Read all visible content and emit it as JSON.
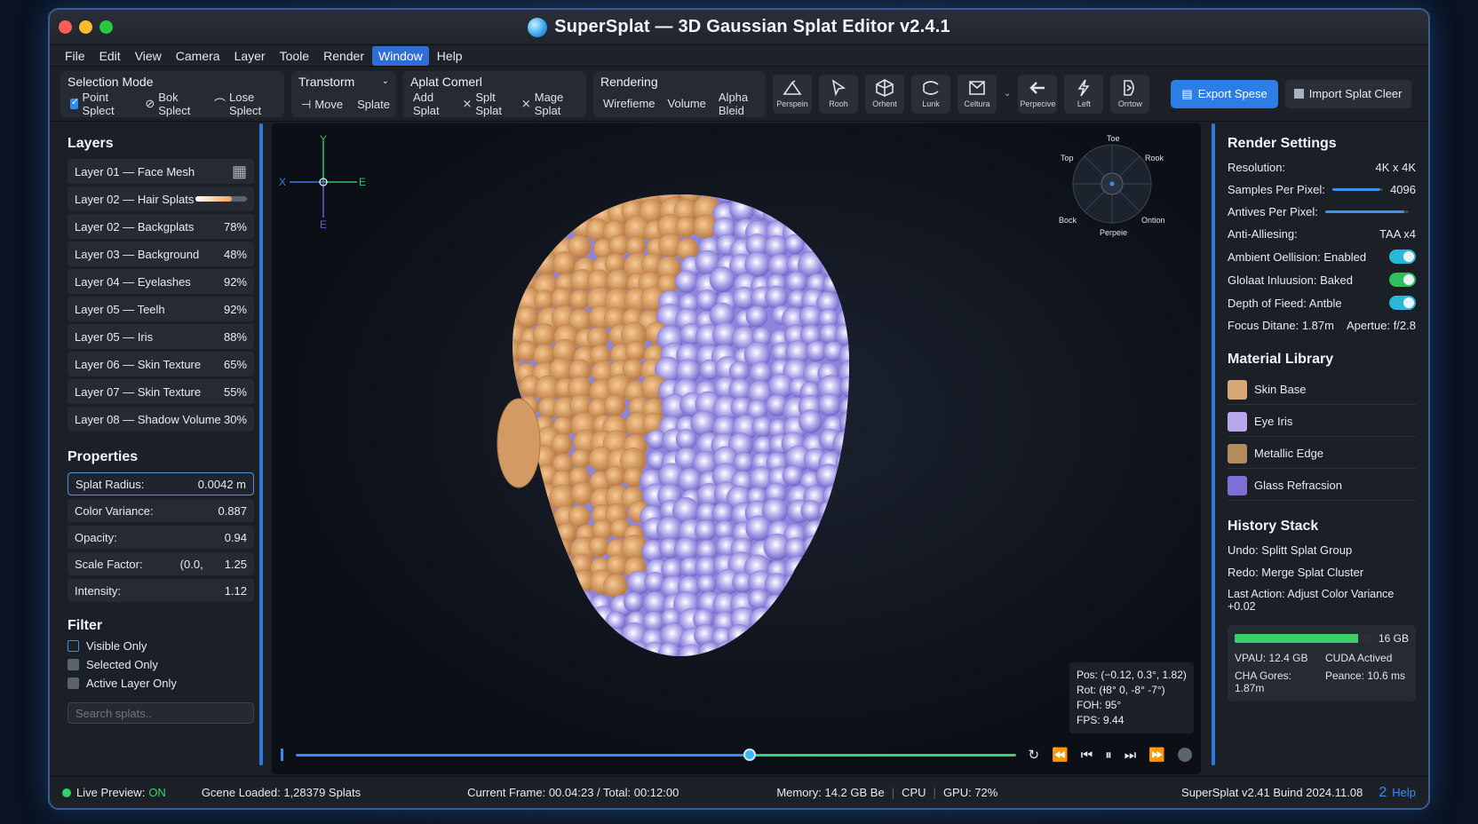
{
  "window": {
    "title": "SuperSplat — 3D Gaussian Splat Editor v2.4.1"
  },
  "menu": [
    "File",
    "Edit",
    "View",
    "Camera",
    "Layer",
    "Toole",
    "Render",
    "Window",
    "Help"
  ],
  "menu_active": "Window",
  "toolbar": {
    "selection": {
      "title": "Selection Mode",
      "items": [
        "Point Splect",
        "Bok Splect",
        "Lose Splect"
      ]
    },
    "transform": {
      "title": "Transtorm",
      "items": [
        "Move",
        "Splate"
      ]
    },
    "aplat": {
      "title": "Aplat Comerl",
      "items": [
        "Add Splat",
        "Splt Splat",
        "Mage Splat"
      ]
    },
    "rendering": {
      "title": "Rendering",
      "items": [
        "Wirefieme",
        "Volume",
        "Alpha Bleid"
      ]
    },
    "views": [
      "Perspein",
      "Rooh",
      "Orhent",
      "Lunk",
      "Celtura",
      "Perpecive",
      "Left",
      "Orrtow"
    ],
    "export_label": "Export Spese",
    "import_label": "Import Splat Cleer"
  },
  "layers_title": "Layers",
  "layers": [
    {
      "name": "Layer 01 — Face Mesh",
      "value": ""
    },
    {
      "name": "Layer 02 — Hair Splats",
      "value": ""
    },
    {
      "name": "Layer 02 — Backgplats",
      "value": "78%"
    },
    {
      "name": "Layer 03 — Background",
      "value": "48%"
    },
    {
      "name": "Layer 04 — Eyelashes",
      "value": "92%"
    },
    {
      "name": "Layer 05 — Teelh",
      "value": "92%"
    },
    {
      "name": "Layer 05 — Iris",
      "value": "88%"
    },
    {
      "name": "Layer 06 — Skin Texture",
      "value": "65%"
    },
    {
      "name": "Layer 07 — Skin Texture",
      "value": "55%"
    },
    {
      "name": "Layer 08 — Shadow Volume",
      "value": "30%"
    }
  ],
  "hair_splats_level": 0.7,
  "properties_title": "Properties",
  "properties": [
    {
      "label": "Splat Radius:",
      "value": "0.0042 m"
    },
    {
      "label": "Color Variance:",
      "value": "0.887"
    },
    {
      "label": "Opacity:",
      "value": "0.94"
    },
    {
      "label": "Scale Factor:",
      "mid": "(0.0,",
      "value": "1.25"
    },
    {
      "label": "Intensity:",
      "value": "1.12"
    }
  ],
  "filter": {
    "title": "Filter",
    "items": [
      "Visible Only",
      "Selected Only",
      "Active Layer Only"
    ],
    "search_placeholder": "Search splats.."
  },
  "viewport": {
    "axis": {
      "y": "Y",
      "x": "X",
      "e1": "E",
      "e2": "E"
    },
    "navcube": {
      "top": "Toe",
      "tl": "Top",
      "tr": "Rook",
      "bl": "Bock",
      "br": "Ontion",
      "bottom": "Perpeie"
    },
    "info": [
      "Pos: (−0.12, 0.3°, 1.82)",
      "Rot: (ɫ8° 0, -8° -7°)",
      "FOH: 95°",
      "FPS: 9.44"
    ],
    "timeline_progress": 0.63
  },
  "render_settings": {
    "title": "Render Settings",
    "rows": [
      {
        "label": "Resolution:",
        "value": "4K x 4K"
      },
      {
        "label": "Samples Per Pixel:",
        "value": "4096",
        "slider": 0.95
      },
      {
        "label": "Antives Per Pixel:",
        "value": "",
        "slider": 0.95
      },
      {
        "label": "Anti-Alliesing:",
        "value": "TAA x4"
      }
    ],
    "toggles": [
      {
        "label": "Ambient Oellision: Enabled",
        "color": "#2bb8d8"
      },
      {
        "label": "Glolaat Inluusion: Baked",
        "color": "#2fbf5c"
      },
      {
        "label": "Depth of Fieed: Antble",
        "color": "#2bb8d8"
      }
    ],
    "focus": "Focus Ditane: 1.87m",
    "aperture": "Apertue: f/2.8"
  },
  "materials": {
    "title": "Material Library",
    "items": [
      {
        "name": "Skin Base",
        "color": "#d8a777"
      },
      {
        "name": "Eye Iris",
        "color": "#b9a7ee"
      },
      {
        "name": "Metallic Edge",
        "color": "#b58a5e"
      },
      {
        "name": "Glass Refracsion",
        "color": "#7e6ed6"
      }
    ]
  },
  "history": {
    "title": "History Stack",
    "items": [
      "Undo: Splitt Splat Group",
      "Redo: Merge Splat Cluster",
      "Last Action: Adjust Color Variance +0.02"
    ]
  },
  "memory": {
    "total": "16 GB",
    "fill": 0.9,
    "grid": [
      "VPAU: 12.4 GB",
      "CUDA Actived",
      "CHA Gores: 1.87m",
      "Peance: 10.6 ms"
    ]
  },
  "status": {
    "live": "Live Preview:",
    "live_state": "ON",
    "scene": "Gcene Loaded: 1,28379 Splats",
    "frame": "Current Frame: 00.04:23 / Total: 00:12:00",
    "memory": "Memory: 14.2 GB Be",
    "cpu": "CPU",
    "gpu": "GPU: 72%",
    "build": "SuperSplat v2.41 Buind 2024.11.08",
    "help": "Help",
    "help_num": "2"
  }
}
